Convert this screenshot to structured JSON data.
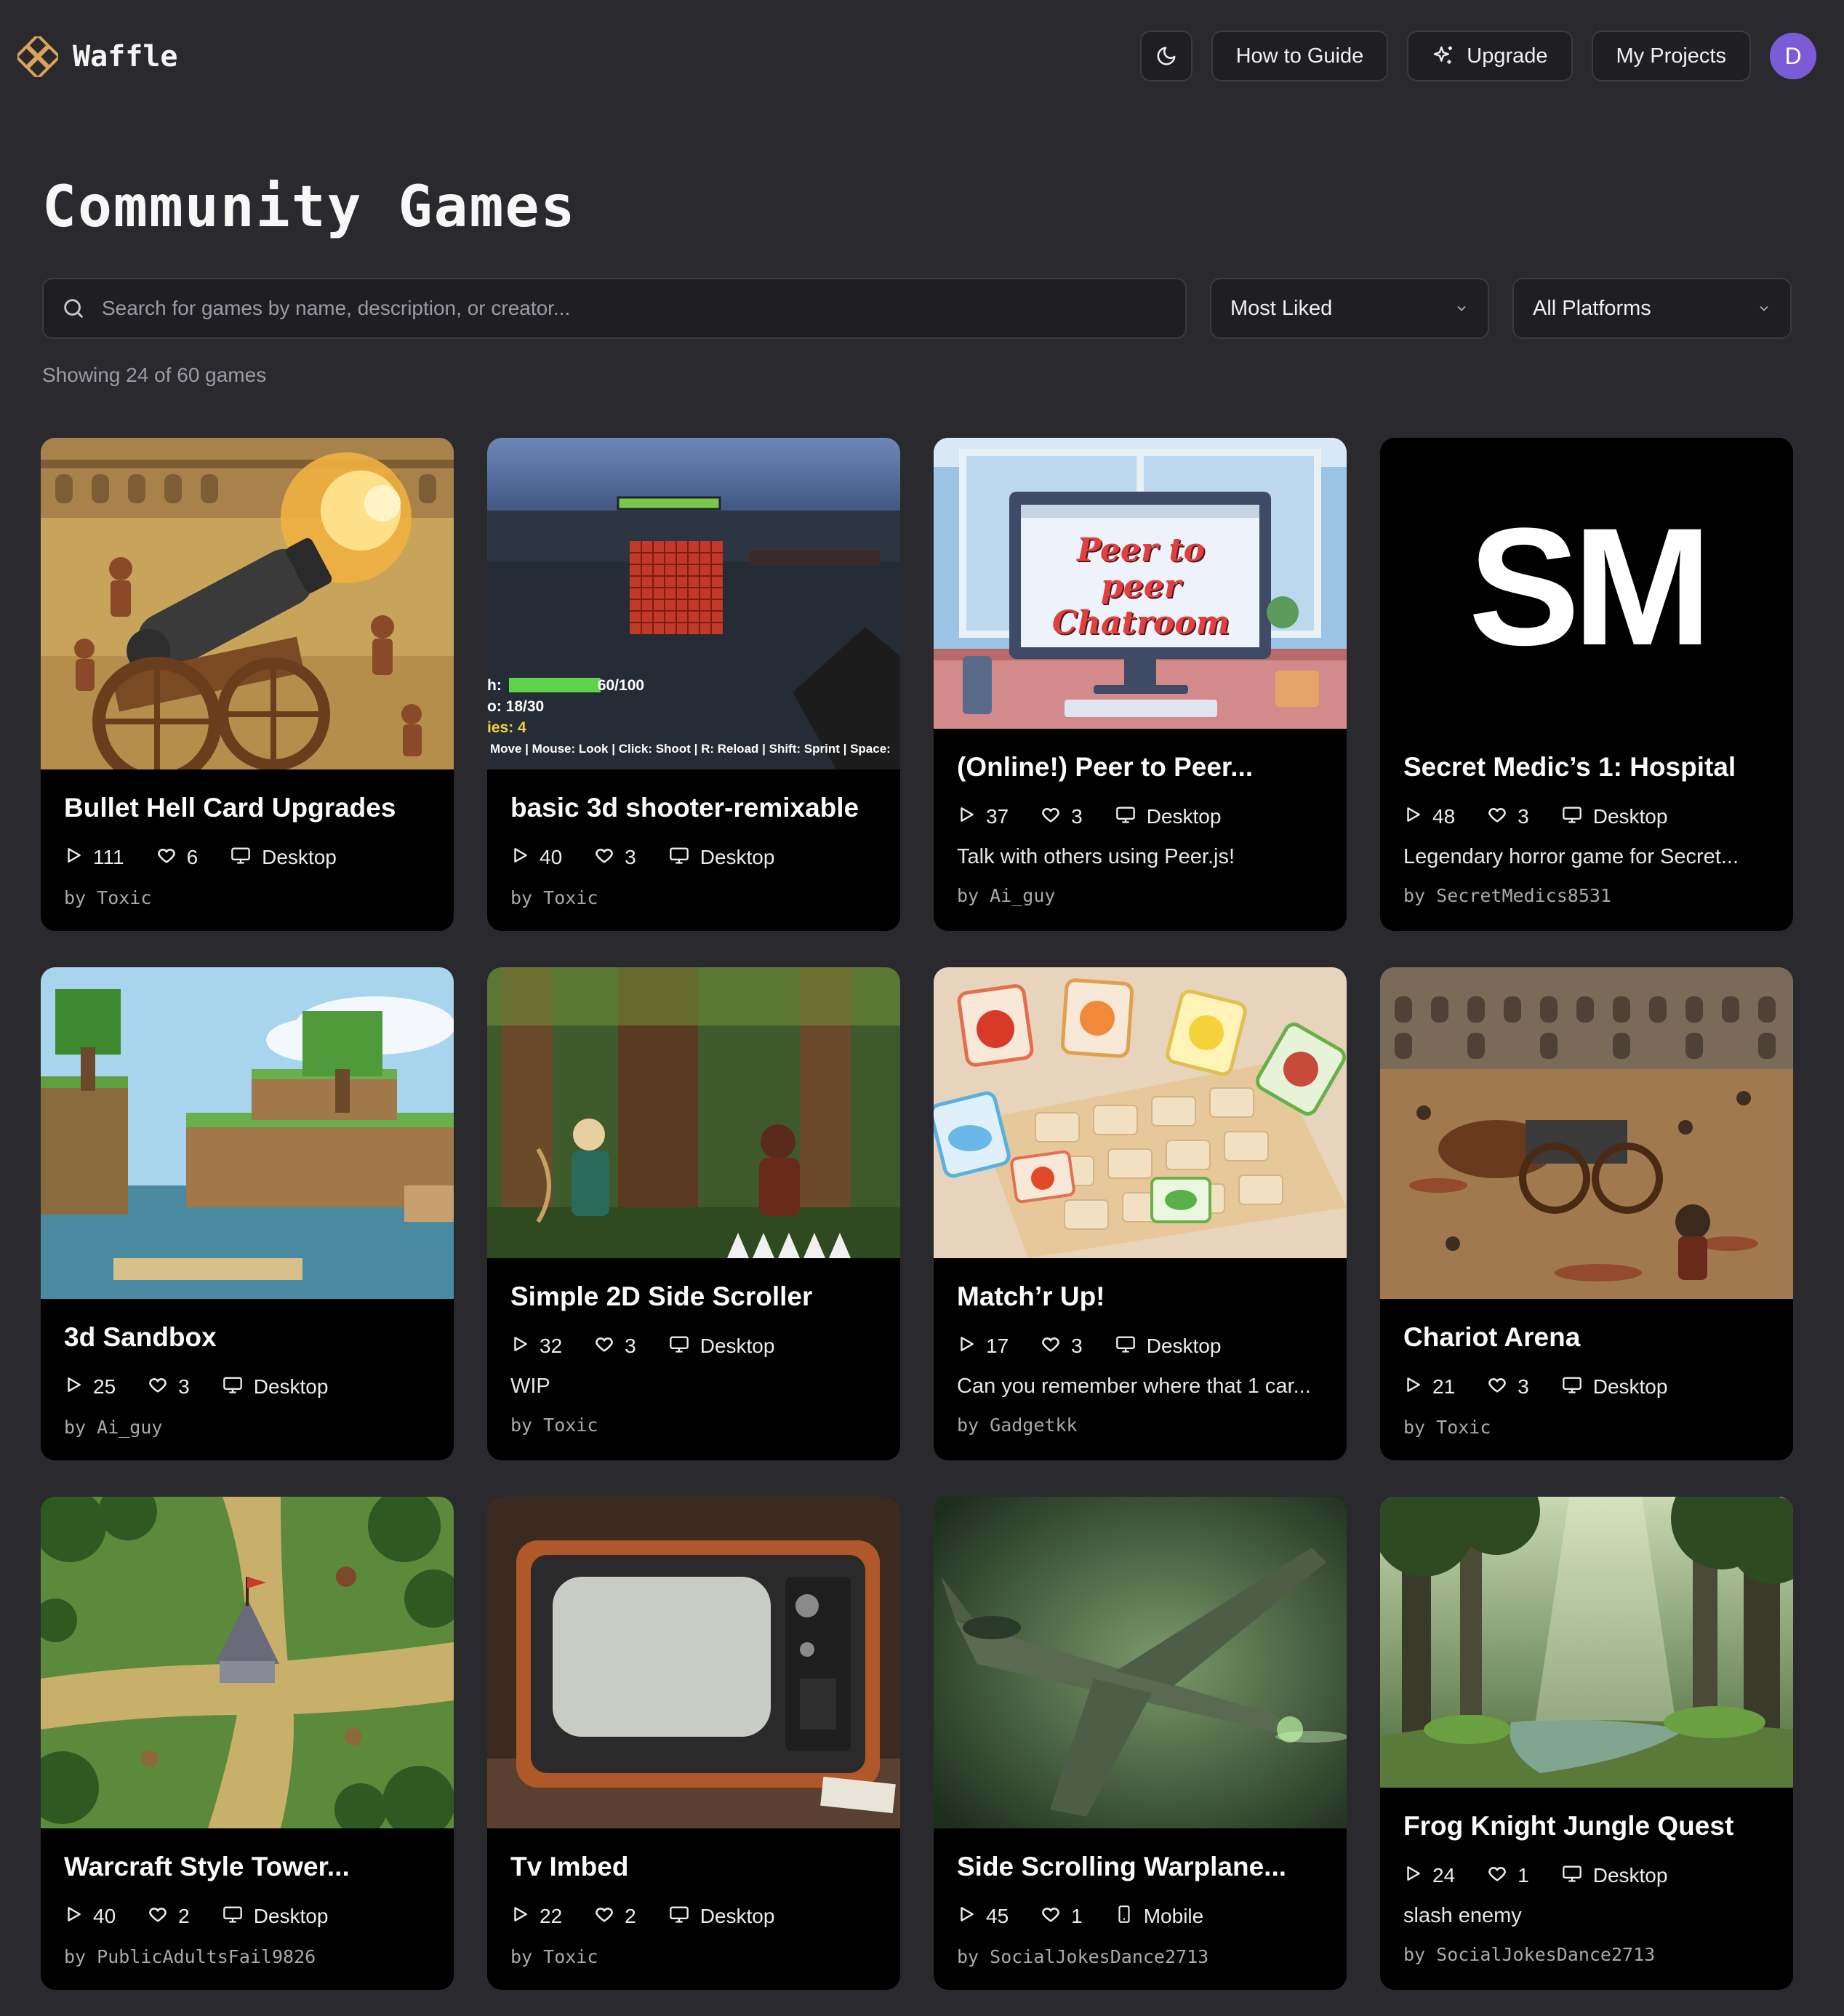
{
  "app": {
    "name": "Waffle"
  },
  "nav": {
    "theme_icon": "moon-icon",
    "guide_label": "How to Guide",
    "upgrade_label": "Upgrade",
    "projects_label": "My Projects",
    "avatar_initial": "D"
  },
  "page": {
    "title": "Community Games",
    "search_placeholder": "Search for games by name, description, or creator...",
    "sort_value": "Most Liked",
    "platform_value": "All Platforms",
    "showing": "Showing 24 of 60 games"
  },
  "colors": {
    "background": "#2a2a2e",
    "card": "#000000",
    "accent": "#7c5cd6"
  },
  "games": [
    {
      "title": "Bullet Hell Card Upgrades",
      "plays": "111",
      "likes": "6",
      "platform": "Desktop",
      "platform_icon": "monitor-icon",
      "description": "",
      "author": "by Toxic"
    },
    {
      "title": "basic 3d shooter-remixable",
      "plays": "40",
      "likes": "3",
      "platform": "Desktop",
      "platform_icon": "monitor-icon",
      "description": "",
      "author": "by Toxic",
      "thumb_text": {
        "health": "h:",
        "health_val": "60/100",
        "ammo": "o: 18/30",
        "enemies": "ies: 4",
        "controls": "Move | Mouse: Look | Click: Shoot | R: Reload | Shift: Sprint | Space:"
      }
    },
    {
      "title": "(Online!) Peer to Peer...",
      "plays": "37",
      "likes": "3",
      "platform": "Desktop",
      "platform_icon": "monitor-icon",
      "description": "Talk with others using Peer.js!",
      "author": "by Ai_guy",
      "thumb_text": {
        "line1": "Peer to peer",
        "line2": "Chatroom"
      }
    },
    {
      "title": "Secret Medic’s 1: Hospital",
      "plays": "48",
      "likes": "3",
      "platform": "Desktop",
      "platform_icon": "monitor-icon",
      "description": "Legendary horror game for Secret...",
      "author": "by SecretMedics8531",
      "thumb_text": {
        "logo": "SM"
      }
    },
    {
      "title": "3d Sandbox",
      "plays": "25",
      "likes": "3",
      "platform": "Desktop",
      "platform_icon": "monitor-icon",
      "description": "",
      "author": "by Ai_guy"
    },
    {
      "title": "Simple 2D Side Scroller",
      "plays": "32",
      "likes": "3",
      "platform": "Desktop",
      "platform_icon": "monitor-icon",
      "description": "WIP",
      "author": "by Toxic"
    },
    {
      "title": "Match’r Up!",
      "plays": "17",
      "likes": "3",
      "platform": "Desktop",
      "platform_icon": "monitor-icon",
      "description": "Can you remember where that 1 car...",
      "author": "by Gadgetkk"
    },
    {
      "title": "Chariot Arena",
      "plays": "21",
      "likes": "3",
      "platform": "Desktop",
      "platform_icon": "monitor-icon",
      "description": "",
      "author": "by Toxic"
    },
    {
      "title": "Warcraft Style Tower...",
      "plays": "40",
      "likes": "2",
      "platform": "Desktop",
      "platform_icon": "monitor-icon",
      "description": "",
      "author": "by PublicAdultsFail9826"
    },
    {
      "title": "Tv Imbed",
      "plays": "22",
      "likes": "2",
      "platform": "Desktop",
      "platform_icon": "monitor-icon",
      "description": "",
      "author": "by Toxic"
    },
    {
      "title": "Side Scrolling Warplane...",
      "plays": "45",
      "likes": "1",
      "platform": "Mobile",
      "platform_icon": "smartphone-icon",
      "description": "",
      "author": "by SocialJokesDance2713"
    },
    {
      "title": "Frog Knight Jungle Quest",
      "plays": "24",
      "likes": "1",
      "platform": "Desktop",
      "platform_icon": "monitor-icon",
      "description": "slash enemy",
      "author": "by SocialJokesDance2713"
    }
  ]
}
